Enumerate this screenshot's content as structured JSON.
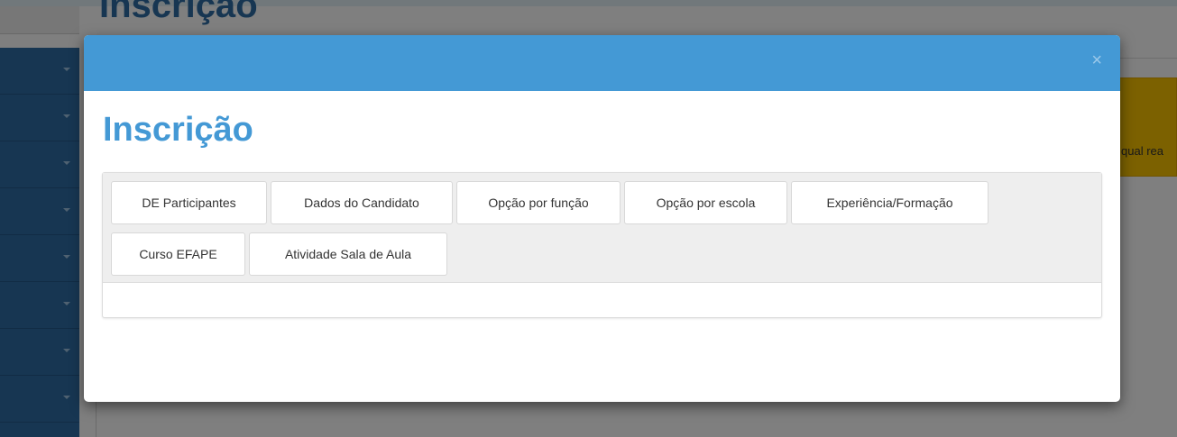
{
  "background": {
    "page_title": "Inscrição",
    "alert_text": "qual rea"
  },
  "modal": {
    "close_label": "×",
    "title": "Inscrição",
    "tabs": [
      {
        "label": "DE Participantes"
      },
      {
        "label": "Dados do Candidato"
      },
      {
        "label": "Opção por função"
      },
      {
        "label": "Opção por escola"
      },
      {
        "label": "Experiência/Formação"
      },
      {
        "label": "Curso EFAPE"
      },
      {
        "label": "Atividade Sala de Aula"
      }
    ]
  },
  "colors": {
    "header_blue": "#4499d5",
    "sidebar_blue": "#2e6da4",
    "alert_yellow": "#f8c200"
  }
}
